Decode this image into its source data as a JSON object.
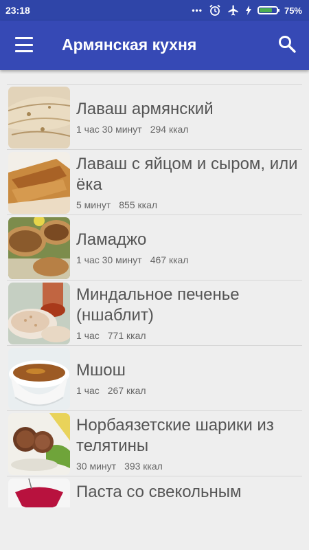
{
  "status": {
    "time": "23:18",
    "battery": "75%",
    "battery_level": 0.75
  },
  "app": {
    "title": "Армянская кухня"
  },
  "recipes": [
    {
      "name": "Лаваш армянский",
      "time": "1 час 30 минут",
      "kcal": "294 ккал",
      "image": "lavash-thumb"
    },
    {
      "name": "Лаваш с яйцом и сыром, или ёка",
      "time": "5 минут",
      "kcal": "855 ккал",
      "image": "lavash-egg-cheese-thumb"
    },
    {
      "name": "Ламаджо",
      "time": "1 час 30 минут",
      "kcal": "467 ккал",
      "image": "lamajo-thumb"
    },
    {
      "name": "Миндальное печенье (ншаблит)",
      "time": "1 час",
      "kcal": "771 ккал",
      "image": "almond-cookies-thumb"
    },
    {
      "name": "Мшош",
      "time": "1 час",
      "kcal": "267 ккал",
      "image": "mshosh-thumb"
    },
    {
      "name": "Норбаязетские шарики из телятины",
      "time": "30 минут",
      "kcal": "393 ккал",
      "image": "meatballs-thumb"
    },
    {
      "name": "Паста со свекольным",
      "image": "pasta-beet-thumb"
    }
  ]
}
